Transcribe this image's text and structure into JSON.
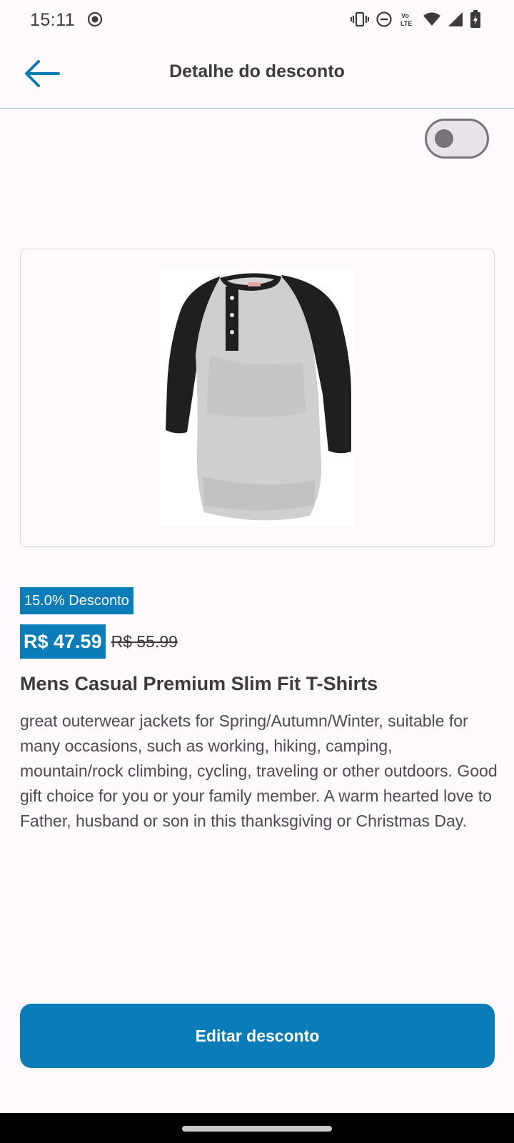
{
  "status_bar": {
    "time": "15:11",
    "icons": [
      "screen-record-icon",
      "vibrate-icon",
      "do-not-disturb-icon",
      "volte-icon",
      "wifi-icon",
      "cell-signal-icon",
      "battery-charging-icon"
    ]
  },
  "app_bar": {
    "title": "Detalhe do desconto",
    "back_icon": "arrow-left-icon"
  },
  "toggle": {
    "state": "off"
  },
  "product": {
    "image": "shirt-image",
    "discount_label": "15.0% Desconto",
    "price": "R$ 47.59",
    "original_price": "R$ 55.99",
    "title": "Mens Casual Premium Slim Fit T-Shirts",
    "description": "great outerwear jackets for Spring/Autumn/Winter, suitable for many occasions, such as working, hiking, camping, mountain/rock climbing, cycling, traveling or other outdoors. Good gift choice for you or your family member. A warm hearted love to Father, husband or son in this thanksgiving or Christmas Day."
  },
  "actions": {
    "edit_label": "Editar desconto"
  },
  "colors": {
    "accent": "#0a7cb8",
    "background": "#fdf9fc",
    "text": "#3c3a3d"
  }
}
